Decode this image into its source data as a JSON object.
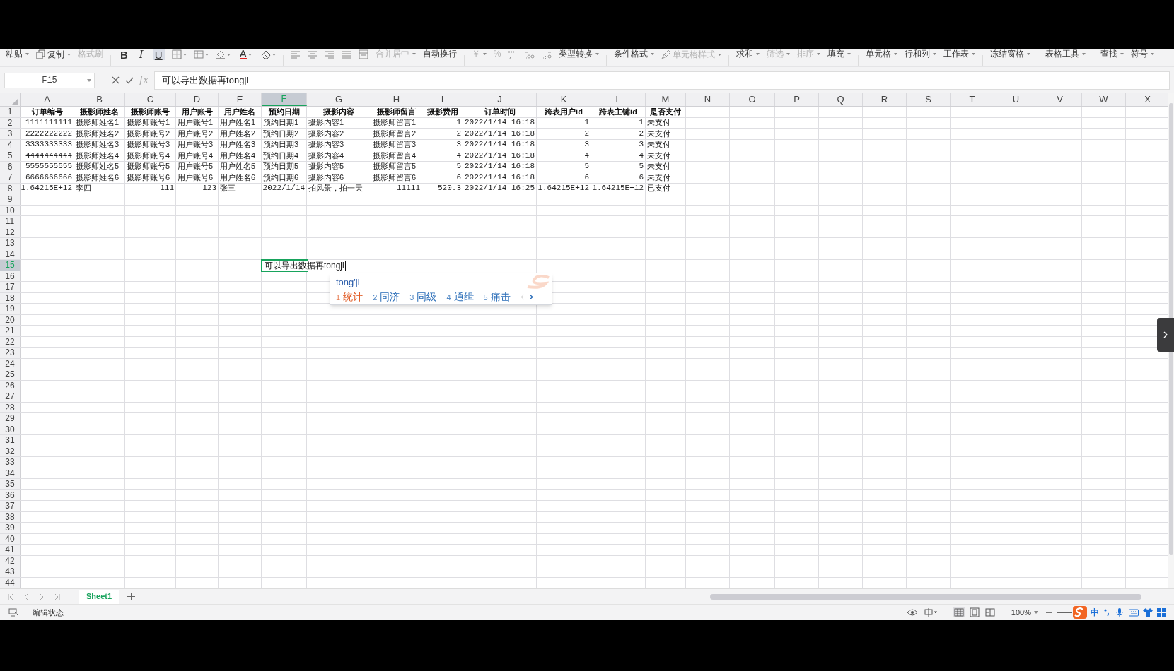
{
  "ribbon": [
    {
      "kind": "text",
      "label": "粘贴",
      "dropdown": true,
      "disabled": false
    },
    {
      "kind": "copy",
      "label": "复制",
      "dropdown": true,
      "disabled": false
    },
    {
      "kind": "text",
      "label": "格式刷",
      "dropdown": false,
      "disabled": true
    },
    {
      "kind": "separator"
    },
    {
      "kind": "bold",
      "label": "B",
      "selected": false
    },
    {
      "kind": "italic",
      "label": "I",
      "selected": false
    },
    {
      "kind": "underline",
      "label": "U",
      "selected": true
    },
    {
      "kind": "border",
      "dropdown": true
    },
    {
      "kind": "fill",
      "dropdown": true
    },
    {
      "kind": "bucket",
      "dropdown": true
    },
    {
      "kind": "font-color",
      "label": "A",
      "dropdown": true
    },
    {
      "kind": "eraser",
      "dropdown": true
    },
    {
      "kind": "separator"
    },
    {
      "kind": "align-left",
      "dropdown": false
    },
    {
      "kind": "align-center",
      "dropdown": false
    },
    {
      "kind": "align-right",
      "dropdown": false
    },
    {
      "kind": "justify",
      "dropdown": false
    },
    {
      "kind": "merge",
      "dropdown": false
    },
    {
      "kind": "text",
      "label": "合并居中",
      "dropdown": true,
      "disabled": true
    },
    {
      "kind": "text",
      "label": "自动换行",
      "dropdown": false,
      "disabled": false
    },
    {
      "kind": "separator"
    },
    {
      "kind": "text",
      "label": "￥",
      "dropdown": true,
      "disabled": true
    },
    {
      "kind": "text",
      "label": "%",
      "dropdown": false,
      "disabled": true
    },
    {
      "kind": "thousands",
      "dropdown": false
    },
    {
      "kind": "decimal-add",
      "dropdown": false
    },
    {
      "kind": "decimal-remove",
      "dropdown": false
    },
    {
      "kind": "text",
      "label": "类型转换",
      "dropdown": true,
      "disabled": false
    },
    {
      "kind": "separator"
    },
    {
      "kind": "text",
      "label": "条件格式",
      "dropdown": true,
      "disabled": false
    },
    {
      "kind": "brush",
      "label": "单元格样式",
      "dropdown": true,
      "disabled": true
    },
    {
      "kind": "separator"
    },
    {
      "kind": "text",
      "label": "求和",
      "dropdown": true,
      "disabled": false
    },
    {
      "kind": "text",
      "label": "筛选",
      "dropdown": true,
      "disabled": true
    },
    {
      "kind": "text",
      "label": "排序",
      "dropdown": true,
      "disabled": true
    },
    {
      "kind": "text",
      "label": "填充",
      "dropdown": true,
      "disabled": false
    },
    {
      "kind": "separator"
    },
    {
      "kind": "text",
      "label": "单元格",
      "dropdown": true,
      "disabled": false
    },
    {
      "kind": "text",
      "label": "行和列",
      "dropdown": true,
      "disabled": false
    },
    {
      "kind": "text",
      "label": "工作表",
      "dropdown": true,
      "disabled": false
    },
    {
      "kind": "separator"
    },
    {
      "kind": "text",
      "label": "冻结窗格",
      "dropdown": true,
      "disabled": false
    },
    {
      "kind": "separator"
    },
    {
      "kind": "text",
      "label": "表格工具",
      "dropdown": true,
      "disabled": false
    },
    {
      "kind": "separator"
    },
    {
      "kind": "text",
      "label": "查找",
      "dropdown": true,
      "disabled": false
    },
    {
      "kind": "text",
      "label": "符号",
      "dropdown": true,
      "disabled": false
    }
  ],
  "formula_bar": {
    "name_box": "F15",
    "fx": "fx",
    "formula": "可以导出数据再tongji"
  },
  "sheet": {
    "columns": [
      {
        "label": "A",
        "selected": false
      },
      {
        "label": "B",
        "selected": false
      },
      {
        "label": "C",
        "selected": false
      },
      {
        "label": "D",
        "selected": false
      },
      {
        "label": "E",
        "selected": false
      },
      {
        "label": "F",
        "selected": true
      },
      {
        "label": "G",
        "selected": false
      },
      {
        "label": "H",
        "selected": false
      },
      {
        "label": "I",
        "selected": false
      },
      {
        "label": "J",
        "selected": false
      },
      {
        "label": "K",
        "selected": false
      },
      {
        "label": "L",
        "selected": false
      },
      {
        "label": "M",
        "selected": false
      },
      {
        "label": "N",
        "selected": false
      },
      {
        "label": "O",
        "selected": false
      },
      {
        "label": "P",
        "selected": false
      },
      {
        "label": "Q",
        "selected": false
      },
      {
        "label": "R",
        "selected": false
      },
      {
        "label": "S",
        "selected": false
      },
      {
        "label": "T",
        "selected": false
      },
      {
        "label": "U",
        "selected": false
      },
      {
        "label": "V",
        "selected": false
      },
      {
        "label": "W",
        "selected": false
      },
      {
        "label": "X",
        "selected": false
      }
    ],
    "row_headers": [
      {
        "label": "1",
        "selected": false
      },
      {
        "label": "2",
        "selected": false
      },
      {
        "label": "3",
        "selected": false
      },
      {
        "label": "4",
        "selected": false
      },
      {
        "label": "5",
        "selected": false
      },
      {
        "label": "6",
        "selected": false
      },
      {
        "label": "7",
        "selected": false
      },
      {
        "label": "8",
        "selected": false
      },
      {
        "label": "9",
        "selected": false
      },
      {
        "label": "10",
        "selected": false
      },
      {
        "label": "11",
        "selected": false
      },
      {
        "label": "12",
        "selected": false
      },
      {
        "label": "13",
        "selected": false
      },
      {
        "label": "14",
        "selected": false
      },
      {
        "label": "15",
        "selected": true
      },
      {
        "label": "16",
        "selected": false
      },
      {
        "label": "17",
        "selected": false
      },
      {
        "label": "18",
        "selected": false
      },
      {
        "label": "19",
        "selected": false
      },
      {
        "label": "20",
        "selected": false
      },
      {
        "label": "21",
        "selected": false
      },
      {
        "label": "22",
        "selected": false
      },
      {
        "label": "23",
        "selected": false
      },
      {
        "label": "24",
        "selected": false
      },
      {
        "label": "25",
        "selected": false
      },
      {
        "label": "26",
        "selected": false
      },
      {
        "label": "27",
        "selected": false
      },
      {
        "label": "28",
        "selected": false
      },
      {
        "label": "29",
        "selected": false
      },
      {
        "label": "30",
        "selected": false
      },
      {
        "label": "31",
        "selected": false
      },
      {
        "label": "32",
        "selected": false
      },
      {
        "label": "33",
        "selected": false
      },
      {
        "label": "34",
        "selected": false
      },
      {
        "label": "35",
        "selected": false
      },
      {
        "label": "36",
        "selected": false
      },
      {
        "label": "37",
        "selected": false
      },
      {
        "label": "38",
        "selected": false
      },
      {
        "label": "39",
        "selected": false
      },
      {
        "label": "40",
        "selected": false
      },
      {
        "label": "41",
        "selected": false
      },
      {
        "label": "42",
        "selected": false
      },
      {
        "label": "43",
        "selected": false
      },
      {
        "label": "44",
        "selected": false
      }
    ],
    "rows": [
      [
        {
          "text": "订单编号",
          "kind": "header"
        },
        {
          "text": "摄影师姓名",
          "kind": "header"
        },
        {
          "text": "摄影师账号",
          "kind": "header"
        },
        {
          "text": "用户账号",
          "kind": "header"
        },
        {
          "text": "用户姓名",
          "kind": "header"
        },
        {
          "text": "预约日期",
          "kind": "header"
        },
        {
          "text": "摄影内容",
          "kind": "header"
        },
        {
          "text": "摄影师留言",
          "kind": "header"
        },
        {
          "text": "摄影费用",
          "kind": "header"
        },
        {
          "text": "订单时间",
          "kind": "header"
        },
        {
          "text": "跨表用户id",
          "kind": "header"
        },
        {
          "text": "跨表主键id",
          "kind": "header"
        },
        {
          "text": "是否支付",
          "kind": "header"
        }
      ],
      [
        {
          "text": "1111111111",
          "kind": "number"
        },
        {
          "text": "摄影师姓名1",
          "kind": "text"
        },
        {
          "text": "摄影师账号1",
          "kind": "text"
        },
        {
          "text": "用户账号1",
          "kind": "text"
        },
        {
          "text": "用户姓名1",
          "kind": "text"
        },
        {
          "text": "预约日期1",
          "kind": "text"
        },
        {
          "text": "摄影内容1",
          "kind": "text"
        },
        {
          "text": "摄影师留言1",
          "kind": "text"
        },
        {
          "text": "1",
          "kind": "number"
        },
        {
          "text": "2022/1/14 16:18",
          "kind": "number"
        },
        {
          "text": "1",
          "kind": "number"
        },
        {
          "text": "1",
          "kind": "number"
        },
        {
          "text": "未支付",
          "kind": "text"
        }
      ],
      [
        {
          "text": "2222222222",
          "kind": "number"
        },
        {
          "text": "摄影师姓名2",
          "kind": "text"
        },
        {
          "text": "摄影师账号2",
          "kind": "text"
        },
        {
          "text": "用户账号2",
          "kind": "text"
        },
        {
          "text": "用户姓名2",
          "kind": "text"
        },
        {
          "text": "预约日期2",
          "kind": "text"
        },
        {
          "text": "摄影内容2",
          "kind": "text"
        },
        {
          "text": "摄影师留言2",
          "kind": "text"
        },
        {
          "text": "2",
          "kind": "number"
        },
        {
          "text": "2022/1/14 16:18",
          "kind": "number"
        },
        {
          "text": "2",
          "kind": "number"
        },
        {
          "text": "2",
          "kind": "number"
        },
        {
          "text": "未支付",
          "kind": "text"
        }
      ],
      [
        {
          "text": "3333333333",
          "kind": "number"
        },
        {
          "text": "摄影师姓名3",
          "kind": "text"
        },
        {
          "text": "摄影师账号3",
          "kind": "text"
        },
        {
          "text": "用户账号3",
          "kind": "text"
        },
        {
          "text": "用户姓名3",
          "kind": "text"
        },
        {
          "text": "预约日期3",
          "kind": "text"
        },
        {
          "text": "摄影内容3",
          "kind": "text"
        },
        {
          "text": "摄影师留言3",
          "kind": "text"
        },
        {
          "text": "3",
          "kind": "number"
        },
        {
          "text": "2022/1/14 16:18",
          "kind": "number"
        },
        {
          "text": "3",
          "kind": "number"
        },
        {
          "text": "3",
          "kind": "number"
        },
        {
          "text": "未支付",
          "kind": "text"
        }
      ],
      [
        {
          "text": "4444444444",
          "kind": "number"
        },
        {
          "text": "摄影师姓名4",
          "kind": "text"
        },
        {
          "text": "摄影师账号4",
          "kind": "text"
        },
        {
          "text": "用户账号4",
          "kind": "text"
        },
        {
          "text": "用户姓名4",
          "kind": "text"
        },
        {
          "text": "预约日期4",
          "kind": "text"
        },
        {
          "text": "摄影内容4",
          "kind": "text"
        },
        {
          "text": "摄影师留言4",
          "kind": "text"
        },
        {
          "text": "4",
          "kind": "number"
        },
        {
          "text": "2022/1/14 16:18",
          "kind": "number"
        },
        {
          "text": "4",
          "kind": "number"
        },
        {
          "text": "4",
          "kind": "number"
        },
        {
          "text": "未支付",
          "kind": "text"
        }
      ],
      [
        {
          "text": "5555555555",
          "kind": "number"
        },
        {
          "text": "摄影师姓名5",
          "kind": "text"
        },
        {
          "text": "摄影师账号5",
          "kind": "text"
        },
        {
          "text": "用户账号5",
          "kind": "text"
        },
        {
          "text": "用户姓名5",
          "kind": "text"
        },
        {
          "text": "预约日期5",
          "kind": "text"
        },
        {
          "text": "摄影内容5",
          "kind": "text"
        },
        {
          "text": "摄影师留言5",
          "kind": "text"
        },
        {
          "text": "5",
          "kind": "number"
        },
        {
          "text": "2022/1/14 16:18",
          "kind": "number"
        },
        {
          "text": "5",
          "kind": "number"
        },
        {
          "text": "5",
          "kind": "number"
        },
        {
          "text": "未支付",
          "kind": "text"
        }
      ],
      [
        {
          "text": "6666666666",
          "kind": "number"
        },
        {
          "text": "摄影师姓名6",
          "kind": "text"
        },
        {
          "text": "摄影师账号6",
          "kind": "text"
        },
        {
          "text": "用户账号6",
          "kind": "text"
        },
        {
          "text": "用户姓名6",
          "kind": "text"
        },
        {
          "text": "预约日期6",
          "kind": "text"
        },
        {
          "text": "摄影内容6",
          "kind": "text"
        },
        {
          "text": "摄影师留言6",
          "kind": "text"
        },
        {
          "text": "6",
          "kind": "number"
        },
        {
          "text": "2022/1/14 16:18",
          "kind": "number"
        },
        {
          "text": "6",
          "kind": "number"
        },
        {
          "text": "6",
          "kind": "number"
        },
        {
          "text": "未支付",
          "kind": "text"
        }
      ],
      [
        {
          "text": "1.64215E+12",
          "kind": "number"
        },
        {
          "text": "李四",
          "kind": "text"
        },
        {
          "text": "111",
          "kind": "number"
        },
        {
          "text": "123",
          "kind": "number"
        },
        {
          "text": "张三",
          "kind": "text"
        },
        {
          "text": "2022/1/14",
          "kind": "number"
        },
        {
          "text": "拍风景，拍一天",
          "kind": "text"
        },
        {
          "text": "11111",
          "kind": "number"
        },
        {
          "text": "520.3",
          "kind": "number"
        },
        {
          "text": "2022/1/14 16:25",
          "kind": "number"
        },
        {
          "text": "1.64215E+12",
          "kind": "number"
        },
        {
          "text": "1.64215E+12",
          "kind": "number"
        },
        {
          "text": "已支付",
          "kind": "text"
        }
      ]
    ],
    "editor": {
      "text": "可以导出数据再tongji"
    }
  },
  "ime": {
    "composition": "tong'ji",
    "candidates": [
      {
        "index": "1",
        "text": "统计",
        "selected": true
      },
      {
        "index": "2",
        "text": "同济",
        "selected": false
      },
      {
        "index": "3",
        "text": "同级",
        "selected": false
      },
      {
        "index": "4",
        "text": "通缉",
        "selected": false
      },
      {
        "index": "5",
        "text": "痛击",
        "selected": false
      }
    ]
  },
  "sheet_tabs": [
    {
      "label": "Sheet1",
      "selected": true
    }
  ],
  "status_bar": {
    "mode": "编辑状态",
    "zoom": "100%",
    "ime_label": "中"
  }
}
